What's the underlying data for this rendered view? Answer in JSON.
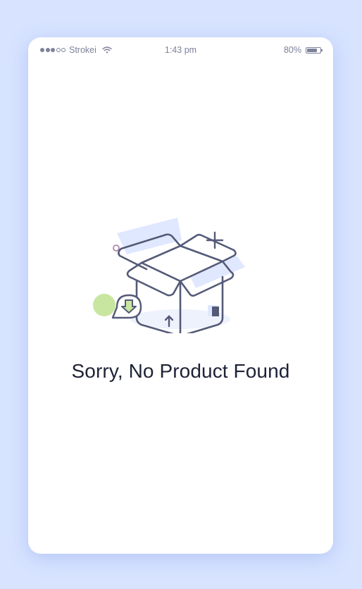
{
  "status_bar": {
    "carrier": "Strokei",
    "time": "1:43 pm",
    "battery": "80%",
    "battery_level": 0.8,
    "signal_bars_filled": 3,
    "signal_bars_total": 5
  },
  "empty_state": {
    "message": "Sorry, No Product Found",
    "illustration": "open-box-icon"
  },
  "colors": {
    "background": "#d7e3ff",
    "card": "#ffffff",
    "stroke": "#545a78",
    "accent_blue": "#dde6ff",
    "accent_green": "#c8e6a0"
  }
}
